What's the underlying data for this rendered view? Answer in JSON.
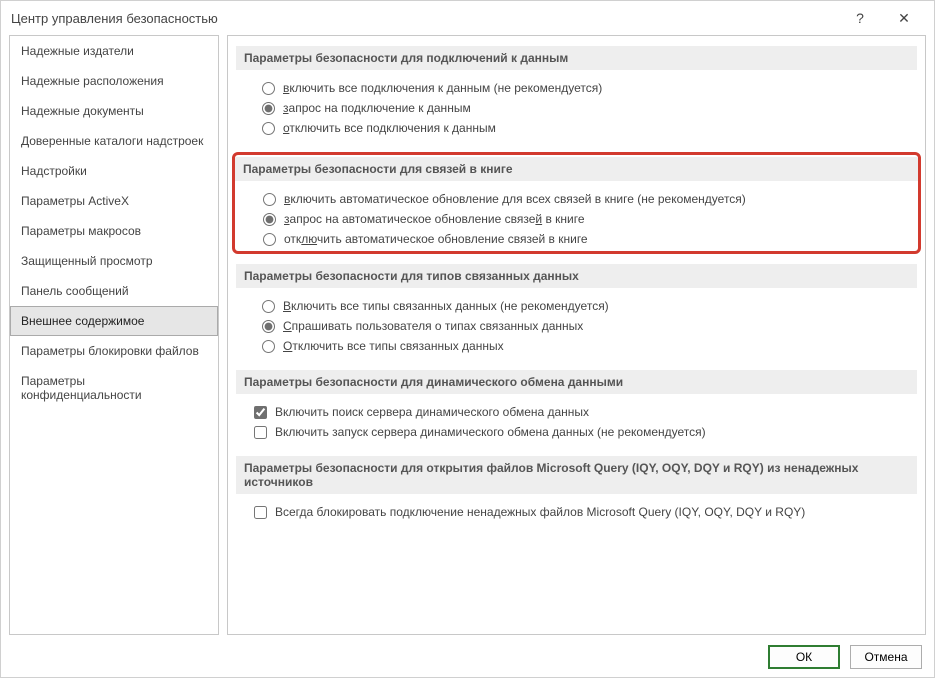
{
  "window": {
    "title": "Центр управления безопасностью",
    "help_icon": "?",
    "close_icon": "✕"
  },
  "sidebar": {
    "items": [
      {
        "label": "Надежные издатели",
        "selected": false
      },
      {
        "label": "Надежные расположения",
        "selected": false
      },
      {
        "label": "Надежные документы",
        "selected": false
      },
      {
        "label": "Доверенные каталоги надстроек",
        "selected": false
      },
      {
        "label": "Надстройки",
        "selected": false
      },
      {
        "label": "Параметры ActiveX",
        "selected": false
      },
      {
        "label": "Параметры макросов",
        "selected": false
      },
      {
        "label": "Защищенный просмотр",
        "selected": false
      },
      {
        "label": "Панель сообщений",
        "selected": false
      },
      {
        "label": "Внешнее содержимое",
        "selected": true
      },
      {
        "label": "Параметры блокировки файлов",
        "selected": false
      },
      {
        "label": "Параметры конфиденциальности",
        "selected": false
      }
    ]
  },
  "groups": [
    {
      "key": "data_connections",
      "header": "Параметры безопасности для подключений к данным",
      "highlight": false,
      "type": "radio",
      "options": [
        {
          "html": "<span class='u'>в</span>ключить все подключения к данным (не рекомендуется)",
          "checked": false
        },
        {
          "html": "<span class='u'>з</span>апрос на подключение к данным",
          "checked": true
        },
        {
          "html": "<span class='u'>о</span>тключить все подключения к данным",
          "checked": false
        }
      ]
    },
    {
      "key": "workbook_links",
      "header": "Параметры безопасности для связей в книге",
      "highlight": true,
      "type": "radio",
      "options": [
        {
          "html": "<span class='u'>в</span>ключить автоматическое обновление для всех связей в книге (не рекомендуется)",
          "checked": false
        },
        {
          "html": "<span class='u'>з</span>апрос на автоматическое обновление связе<span class='u'>й</span> в книге",
          "checked": true
        },
        {
          "html": "отк<span class='u'>лю</span>чить автоматическое обновление связей в книге",
          "checked": false
        }
      ]
    },
    {
      "key": "linked_data_types",
      "header": "Параметры безопасности для типов связанных данных",
      "highlight": false,
      "type": "radio",
      "options": [
        {
          "html": "<span class='u'>В</span>ключить все типы связанных данных (не рекомендуется)",
          "checked": false
        },
        {
          "html": "<span class='u'>С</span>прашивать пользователя о типах связанных данных",
          "checked": true
        },
        {
          "html": "<span class='u'>О</span>тключить все типы связанных данных",
          "checked": false
        }
      ]
    },
    {
      "key": "dde",
      "header": "Параметры безопасности для динамического обмена данными",
      "highlight": false,
      "type": "checkbox",
      "options": [
        {
          "html": "Включить поиск сервера <span class='u'>д</span>инамического обмена данных",
          "checked": true
        },
        {
          "html": "Включить запуск сервера <span class='u'>д</span>инамического обмена данных (не рекомендуется)",
          "checked": false
        }
      ]
    },
    {
      "key": "msquery",
      "header": "Параметры безопасности для открытия файлов Microsoft Query (IQY, OQY, DQY и RQY) из ненадежных источников",
      "highlight": false,
      "type": "checkbox",
      "options": [
        {
          "html": "Всегда блокировать подключение ненадежных файлов Microsoft Query (IQY, OQY, DQY и RQY)",
          "checked": false
        }
      ]
    }
  ],
  "footer": {
    "ok": "ОК",
    "cancel": "Отмена"
  }
}
